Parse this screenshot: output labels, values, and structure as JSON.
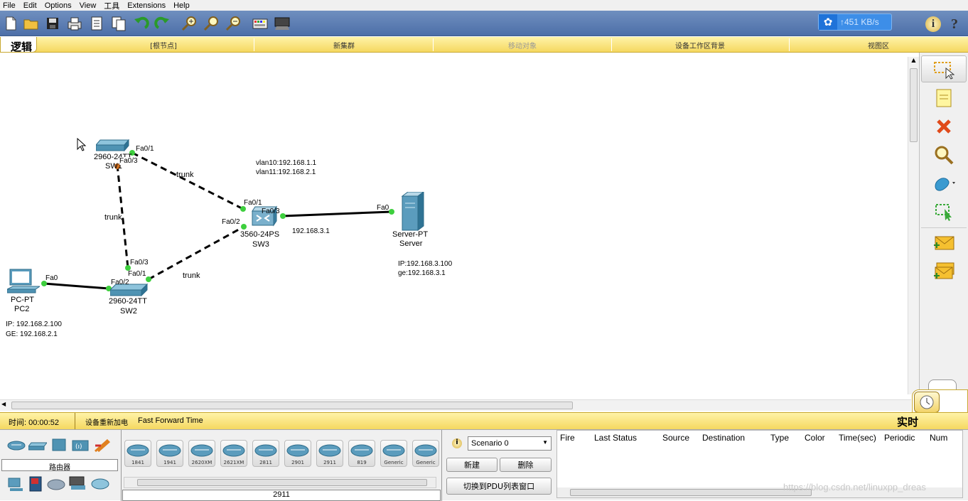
{
  "menu": [
    "File",
    "Edit",
    "Options",
    "View",
    "工具",
    "Extensions",
    "Help"
  ],
  "network_speed": "↑451 KB/s",
  "toolbar_icons": [
    "new-file-icon",
    "open-folder-icon",
    "save-icon",
    "print-icon",
    "activity-wizard-icon",
    "copy-icon",
    "undo-icon",
    "redo-icon",
    "zoom-in-icon",
    "zoom-reset-icon",
    "zoom-out-icon",
    "palette-icon",
    "custom-device-icon"
  ],
  "workspace_bar": {
    "logic_label": "逻辑",
    "root": "[根节点]",
    "new_cluster": "新集群",
    "move_object": "移动对象",
    "background": "设备工作区背景",
    "viewport": "视图区"
  },
  "topology": {
    "devices": [
      {
        "id": "SW1",
        "model": "2960-24TT",
        "name": "SW1"
      },
      {
        "id": "SW2",
        "model": "2960-24TT",
        "name": "SW2"
      },
      {
        "id": "SW3",
        "model": "3560-24PS",
        "name": "SW3"
      },
      {
        "id": "PC2",
        "model": "PC-PT",
        "name": "PC2"
      },
      {
        "id": "Server",
        "model": "Server-PT",
        "name": "Server"
      }
    ],
    "ports": {
      "sw1_fa01": "Fa0/1",
      "sw1_fa03": "Fa0/3",
      "sw3_fa01": "Fa0/1",
      "sw3_fa03": "Fa0/3",
      "sw3_fa02": "Fa0/2",
      "sw2_fa03": "Fa0/3",
      "sw2_fa01": "Fa0/1",
      "sw2_fa02": "Fa0/2",
      "pc_fa0": "Fa0",
      "server_fa0": "Fa0"
    },
    "link_labels": {
      "trunk1": "trunk",
      "trunk2": "trunk",
      "trunk3": "trunk"
    },
    "notes": {
      "vlan10": "vlan10:192.168.1.1",
      "vlan11": "vlan11:192.168.2.1",
      "sw3_ip": "192.168.3.1",
      "server_ip": "IP:192.168.3.100",
      "server_gw": "ge:192.168.3.1",
      "pc_ip": "IP:  192.168.2.100",
      "pc_gw": "GE:  192.168.2.1"
    }
  },
  "status": {
    "time": "时间: 00:00:52",
    "reload": "设备重新加电",
    "fast_forward": "Fast Forward Time",
    "mode": "实时"
  },
  "device_panel": {
    "category_label": "路由器",
    "models": [
      "1841",
      "1941",
      "2620XM",
      "2621XM",
      "2811",
      "2901",
      "2911",
      "819",
      "Generic",
      "Generic"
    ],
    "selected": "2911"
  },
  "scenario": {
    "selected": "Scenario 0",
    "new": "新建",
    "delete": "删除",
    "toggle_pdu": "切换到PDU列表窗口"
  },
  "pdu_columns": [
    "Fire",
    "Last Status",
    "Source",
    "Destination",
    "Type",
    "Color",
    "Time(sec)",
    "Periodic",
    "Num"
  ],
  "watermark": "https://blog.csdn.net/linuxpp_dreas"
}
